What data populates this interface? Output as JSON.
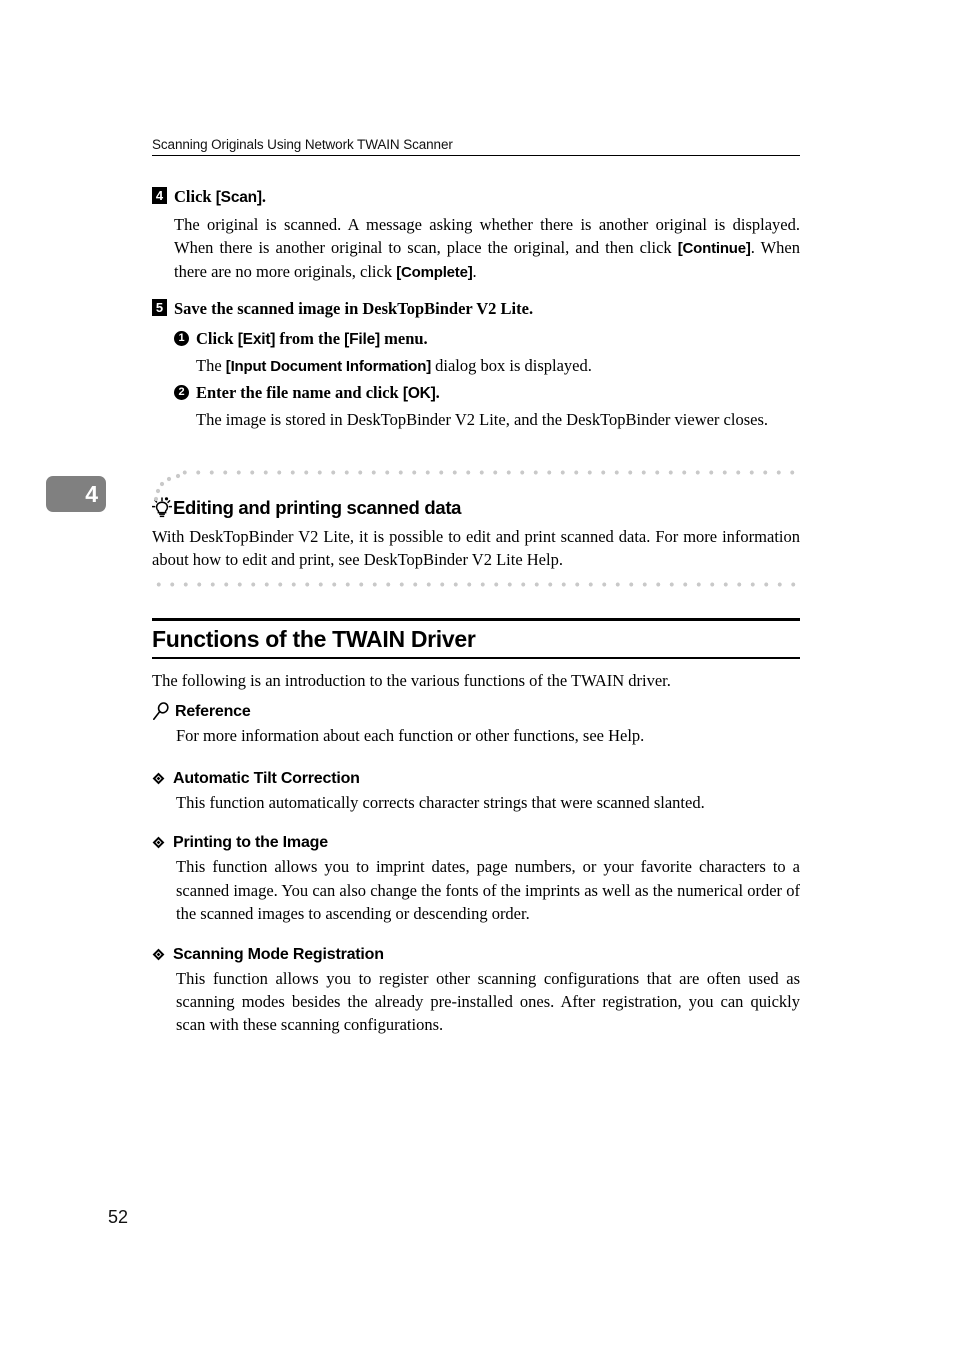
{
  "header": {
    "running_title": "Scanning Originals Using Network TWAIN Scanner"
  },
  "chapter_tab": {
    "number": "4"
  },
  "steps": [
    {
      "badge": "4",
      "title_prefix": "Click ",
      "title_token": "[Scan]",
      "title_suffix": ".",
      "body_1": "The original is scanned. A message asking whether there is another original is displayed. When there is another original to scan, place the original, and then click ",
      "body_token_1": "[Continue]",
      "body_2": ". When there are no more originals, click ",
      "body_token_2": "[Complete]",
      "body_3": "."
    },
    {
      "badge": "5",
      "title": "Save the scanned image in DeskTopBinder V2 Lite.",
      "substeps": [
        {
          "badge": "1",
          "head_prefix": "Click ",
          "head_token_1": "[Exit]",
          "head_middle": " from the ",
          "head_token_2": "[File]",
          "head_suffix": " menu.",
          "body_prefix": "The ",
          "body_token": "[Input Document Information]",
          "body_suffix": " dialog box is displayed."
        },
        {
          "badge": "2",
          "head_prefix": "Enter the file name and click ",
          "head_token_1": "[OK]",
          "head_middle": "",
          "head_token_2": "",
          "head_suffix": ".",
          "body_prefix": "The image is stored in DeskTopBinder V2 Lite, and the DeskTopBinder viewer closes.",
          "body_token": "",
          "body_suffix": ""
        }
      ]
    }
  ],
  "tip": {
    "icon": "lightbulb-icon",
    "title": "Editing and printing scanned data",
    "text": "With DeskTopBinder V2 Lite, it is possible to edit and print scanned data. For more information about how to edit and print, see DeskTopBinder V2 Lite Help."
  },
  "section": {
    "title": "Functions of the TWAIN Driver",
    "intro": "The following is an introduction to the various functions of the TWAIN driver."
  },
  "reference": {
    "icon": "magnifier-icon",
    "title": "Reference",
    "text": "For more information about each function or other functions, see Help."
  },
  "features": [
    {
      "bullet": "diamond-bullet-icon",
      "title": "Automatic Tilt Correction",
      "text": "This function automatically corrects character strings that were scanned slanted."
    },
    {
      "bullet": "diamond-bullet-icon",
      "title": "Printing to the Image",
      "text": "This function allows you to imprint dates, page numbers, or your favorite characters to a scanned image. You can also change the fonts of the imprints as well as the numerical order of the scanned images to ascending or descending order."
    },
    {
      "bullet": "diamond-bullet-icon",
      "title": "Scanning Mode Registration",
      "text": "This function allows you to register other scanning configurations that are often used as scanning modes besides the already pre-installed ones. After registration, you can quickly scan with these scanning configurations."
    }
  ],
  "footer": {
    "page_number": "52"
  },
  "colors": {
    "chapter_tab_bg": "#808080",
    "dot_gray": "#c9c9c9",
    "rule_black": "#000000"
  }
}
